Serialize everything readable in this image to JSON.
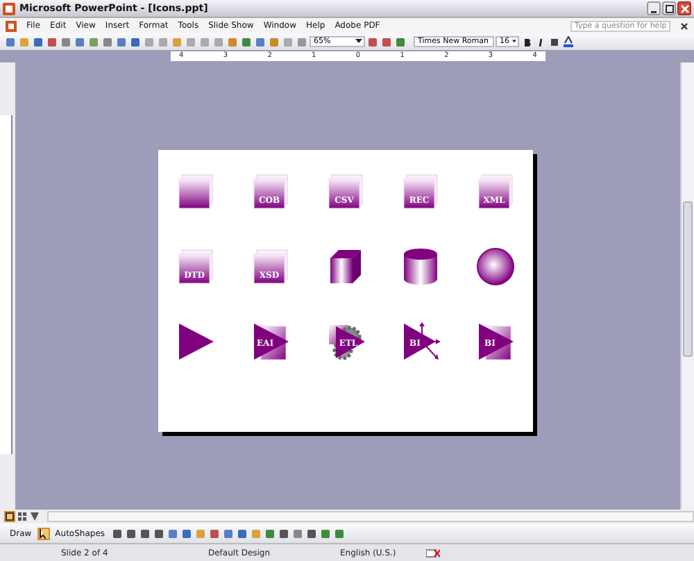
{
  "window": {
    "title": "Microsoft PowerPoint - [Icons.ppt]"
  },
  "menu": [
    "File",
    "Edit",
    "View",
    "Insert",
    "Format",
    "Tools",
    "Slide Show",
    "Window",
    "Help",
    "Adobe PDF"
  ],
  "help": {
    "placeholder": "Type a question for help"
  },
  "toolbar": {
    "zoom": "65%",
    "font": "Times New Roman",
    "size": "16"
  },
  "ruler": [
    "4",
    "3",
    "2",
    "1",
    "0",
    "1",
    "2",
    "3",
    "4"
  ],
  "slide": {
    "icons": [
      {
        "kind": "doc"
      },
      {
        "kind": "doc",
        "label": "COB"
      },
      {
        "kind": "doc",
        "label": "CSV"
      },
      {
        "kind": "doc",
        "label": "REC"
      },
      {
        "kind": "doc",
        "label": "XML"
      },
      {
        "kind": "doc",
        "label": "DTD"
      },
      {
        "kind": "doc",
        "label": "XSD"
      },
      {
        "kind": "cube"
      },
      {
        "kind": "cylinder"
      },
      {
        "kind": "sphere"
      },
      {
        "kind": "triangle"
      },
      {
        "kind": "triangle-doc",
        "label": "EAI"
      },
      {
        "kind": "gear-triangle",
        "label": "ETL"
      },
      {
        "kind": "triangle-arrows",
        "label": "BI"
      },
      {
        "kind": "triangle-doc",
        "label": "BI"
      }
    ]
  },
  "draw_toolbar": {
    "draw": "Draw",
    "autoshapes": "AutoShapes"
  },
  "status_bar": {
    "slide": "Slide 2 of 4",
    "design": "Default Design",
    "language": "English (U.S.)"
  }
}
